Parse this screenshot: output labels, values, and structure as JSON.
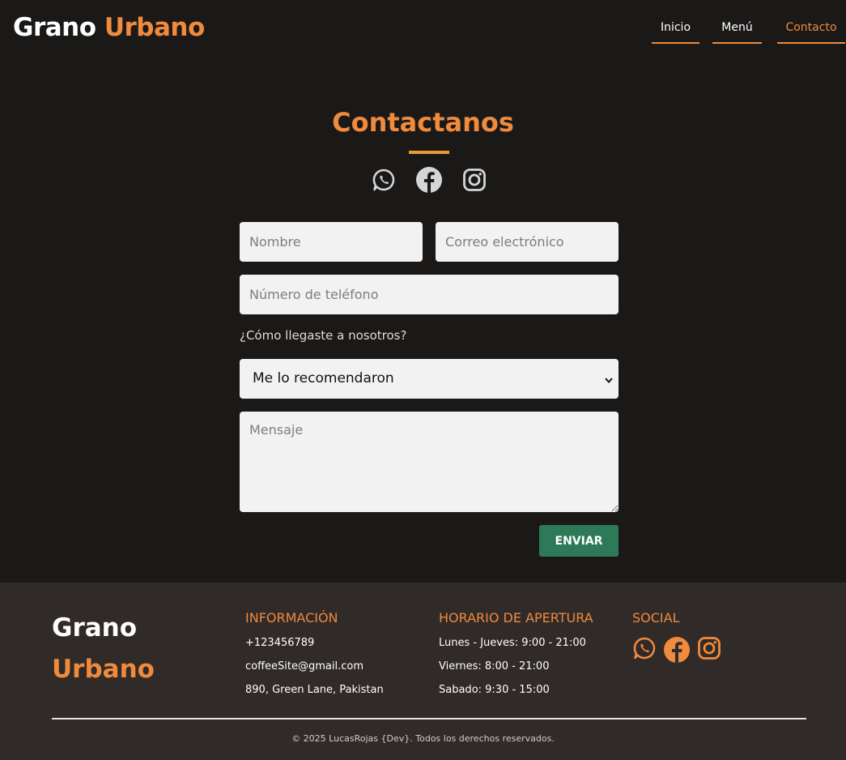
{
  "header": {
    "logo_first": "Grano",
    "logo_second": "Urbano",
    "nav": [
      {
        "label": "Inicio",
        "active": false
      },
      {
        "label": "Menú",
        "active": false
      },
      {
        "label": "Contacto",
        "active": true
      }
    ]
  },
  "contact": {
    "title": "Contactanos",
    "social_icons": [
      "whatsapp-icon",
      "facebook-icon",
      "instagram-icon"
    ],
    "form": {
      "name_placeholder": "Nombre",
      "email_placeholder": "Correo electrónico",
      "phone_placeholder": "Número de teléfono",
      "question": "¿Cómo llegaste a nosotros?",
      "source_selected": "Me lo recomendaron",
      "message_placeholder": "Mensaje",
      "submit_label": "ENVIAR"
    }
  },
  "footer": {
    "logo_first": "Grano",
    "logo_second": "Urbano",
    "info_title": "INFORMACIÓN",
    "info_items": [
      "+123456789",
      "coffeeSite@gmail.com",
      "890, Green Lane, Pakistan"
    ],
    "hours_title": "HORARIO DE APERTURA",
    "hours_items": [
      "Lunes - Jueves: 9:00 - 21:00",
      "Viernes: 8:00 - 21:00",
      "Sabado: 9:30 - 15:00"
    ],
    "social_title": "SOCIAL",
    "copyright": "© 2025 LucasRojas {Dev}. Todos los derechos reservados."
  },
  "colors": {
    "background": "#1b1918",
    "accent": "#f08a3c",
    "footer_bg": "#302a29",
    "button": "#2e7a58"
  }
}
